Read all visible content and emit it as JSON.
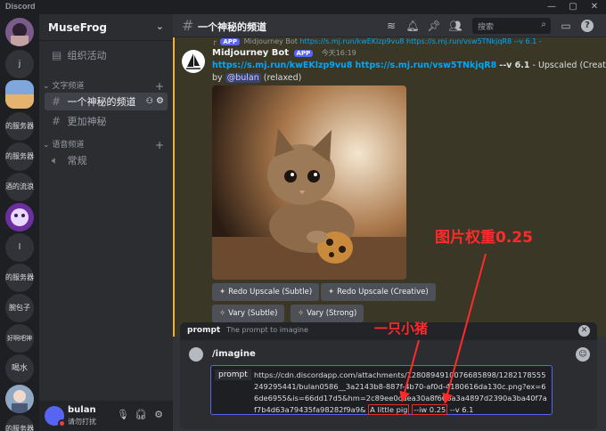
{
  "window": {
    "app_name": "Discord",
    "controls": [
      "—",
      "▢",
      "✕"
    ]
  },
  "servers": [
    {
      "label": "",
      "kind": "avatar"
    },
    {
      "label": "j",
      "kind": "letter"
    },
    {
      "label": "",
      "kind": "image"
    },
    {
      "label": "的服务器",
      "kind": "text"
    },
    {
      "label": "的服务器",
      "kind": "text"
    },
    {
      "label": "酒的流浪",
      "kind": "text"
    },
    {
      "label": "",
      "kind": "avatar"
    },
    {
      "label": "l",
      "kind": "letter"
    },
    {
      "label": "的服务器",
      "kind": "text"
    },
    {
      "label": "腕包子",
      "kind": "text"
    },
    {
      "label": "好啊吧神",
      "kind": "text"
    },
    {
      "label": "喝水",
      "kind": "text"
    },
    {
      "label": "",
      "kind": "avatar"
    },
    {
      "label": "的服务器",
      "kind": "text"
    }
  ],
  "sidebar": {
    "guild_name": "MuseFrog",
    "activity": "组织活动",
    "text_category": "文字频道",
    "voice_category": "语音频道",
    "channels": [
      {
        "name": "一个神秘的频道",
        "selected": true
      },
      {
        "name": "更加神秘",
        "selected": false
      }
    ],
    "voice_channels": [
      {
        "name": "常规"
      }
    ],
    "user": {
      "name": "bulan",
      "status": "请勿打扰"
    }
  },
  "header": {
    "channel_title": "一个神秘的频道",
    "search_placeholder": "搜索"
  },
  "message": {
    "reply_line": {
      "app_badge": "APP",
      "author": "Midjourney Bot",
      "text": "https://s.mj.run/kwEKlzp9vu8 https://s.mj.run/vsw5TNkjqR8 --v 6.1 -"
    },
    "author": "Midjourney Bot",
    "app_badge": "APP",
    "timestamp": "今天16:19",
    "link1": "https://s.mj.run/kwEKlzp9vu8",
    "link2": "https://s.mj.run/vsw5TNkjqR8",
    "suffix": "--v 6.1",
    "upscaled": "- Upscaled (Creative)",
    "by": "by",
    "mention": "@bulan",
    "mode": "(relaxed)",
    "buttons": {
      "redo_subtle": "Redo Upscale (Subtle)",
      "redo_creative": "Redo Upscale (Creative)",
      "vary_subtle": "Vary (Subtle)",
      "vary_strong": "Vary (Strong)"
    }
  },
  "prompt_panel": {
    "header_name": "prompt",
    "header_desc": "The prompt to imagine",
    "command": "/imagine",
    "field_label": "prompt",
    "value_part1": "https://cdn.discordapp.com/attachments/1280894910076685898/1282178555249295441/bulan0586__3a2143b8-887f-4b70-af0d-4180616da130c.png?ex=66de6955&is=66dd17d5&hm=2c89ee0cdea30a8f66ba3a4897d2390a3ba40f7af7b4d63a79435fa98282f9a9& ",
    "value_highlight1": "A little pig",
    "value_highlight2": "--iw 0.25",
    "value_tail": " --v 6.1"
  },
  "annotations": {
    "weight_label": "图片权重0.25",
    "pig_label": "一只小猪",
    "color": "#ff2a2a"
  }
}
